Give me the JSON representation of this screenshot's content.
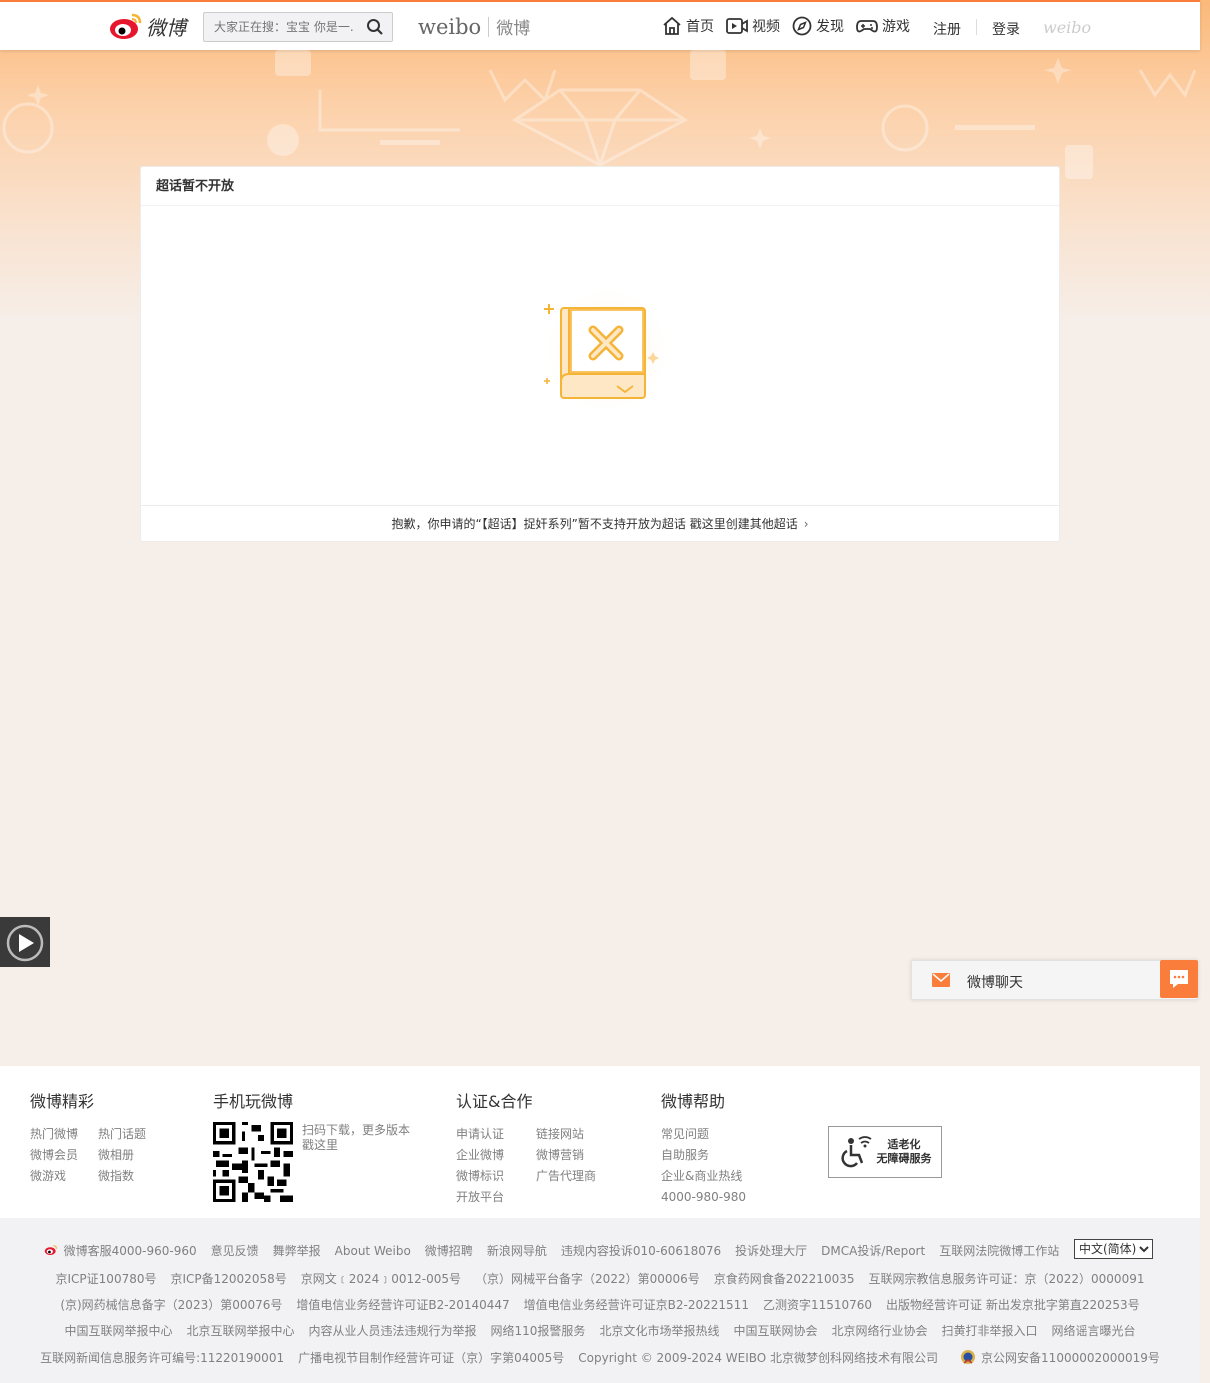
{
  "header": {
    "logo_text": "微博",
    "search_placeholder": "大家正在搜：宝宝 你是一...",
    "brand_en": "weibo",
    "brand_cn": "微博",
    "nav": [
      {
        "label": "首页",
        "icon": "home-icon"
      },
      {
        "label": "视频",
        "icon": "video-icon"
      },
      {
        "label": "发现",
        "icon": "compass-icon"
      },
      {
        "label": "游戏",
        "icon": "gamepad-icon"
      }
    ],
    "register": "注册",
    "login": "登录",
    "weibo_mark": "weibo"
  },
  "card": {
    "title": "超话暂不开放",
    "footer_text": "抱歉，你申请的“【超话】捉奸系列”暂不支持开放为超话 戳这里创建其他超话",
    "chevron": "›"
  },
  "chat": {
    "label": "微博聊天"
  },
  "footer": {
    "col1": {
      "title": "微博精彩",
      "links": [
        "热门微博",
        "热门话题",
        "微博会员",
        "微相册",
        "微游戏",
        "微指数"
      ]
    },
    "col2": {
      "title": "手机玩微博",
      "qr_text": "扫码下载，更多版本戳这里"
    },
    "col3": {
      "title": "认证&合作",
      "links": [
        "申请认证",
        "链接网站",
        "企业微博",
        "微博营销",
        "微博标识",
        "广告代理商",
        "开放平台"
      ]
    },
    "col4": {
      "title": "微博帮助",
      "links": [
        "常见问题",
        "自助服务",
        "企业&商业热线",
        "4000-980-980"
      ]
    },
    "a11y": {
      "line1": "适老化",
      "line2": "无障碍服务"
    }
  },
  "bottom": {
    "row1": [
      "微博客服4000-960-960",
      "意见反馈",
      "舞弊举报",
      "About Weibo",
      "微博招聘",
      "新浪网导航",
      "违规内容投诉010-60618076",
      "投诉处理大厅",
      "DMCA投诉/Report",
      "互联网法院微博工作站"
    ],
    "language": "中文(简体)",
    "row2": [
      "京ICP证100780号",
      "京ICP备12002058号",
      "京网文﹝2024﹞0012-005号",
      "（京）网械平台备字（2022）第00006号",
      "京食药网食备202210035",
      "互联网宗教信息服务许可证：京（2022）0000091"
    ],
    "row3": [
      "(京)网药械信息备字（2023）第00076号",
      "增值电信业务经营许可证B2-20140447",
      "增值电信业务经营许可证京B2-20221511",
      "乙测资字11510760",
      "出版物经营许可证 新出发京批字第直220253号"
    ],
    "row4": [
      "中国互联网举报中心",
      "北京互联网举报中心",
      "内容从业人员违法违规行为举报",
      "网络110报警服务",
      "北京文化市场举报热线",
      "中国互联网协会",
      "北京网络行业协会",
      "扫黄打非举报入口",
      "网络谣言曝光台"
    ],
    "row5": [
      "互联网新闻信息服务许可编号:11220190001",
      "广播电视节目制作经营许可证（京）字第04005号",
      "Copyright © 2009-2024 WEIBO 北京微梦创科网络技术有限公司",
      "京公网安备11000002000019号"
    ]
  },
  "colors": {
    "accent": "#fa7d3c",
    "illustration": "#f5b436"
  }
}
